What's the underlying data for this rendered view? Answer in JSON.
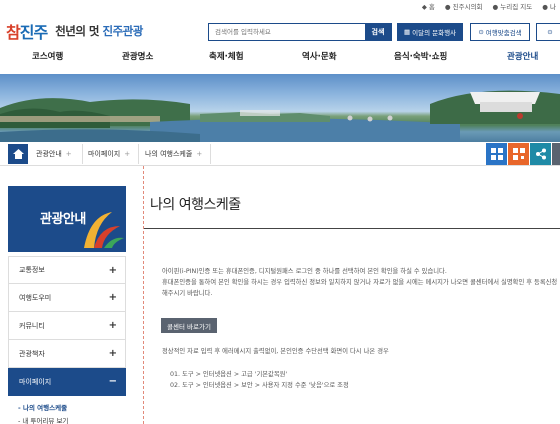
{
  "util_bar": [
    "홈",
    "진주시의회",
    "누리집 지도",
    "나"
  ],
  "logo": {
    "mark_left": "참",
    "mark_right": "진주",
    "slogan_pre": "천년의 멋",
    "slogan_bold": "진주관광"
  },
  "search": {
    "placeholder": "검색어를 입력하세요",
    "button": "검색"
  },
  "header_buttons": {
    "culture": "이달의 문화행사",
    "tailored": "여행맞춤검색",
    "third": ""
  },
  "gnb": [
    "코스여행",
    "관광명소",
    "축제·체험",
    "역사·문화",
    "음식·숙박·쇼핑",
    "관광안내"
  ],
  "breadcrumb": [
    "관광안내",
    "마이페이지",
    "나의 여행스케줄"
  ],
  "sidebar": {
    "title": "관광안내",
    "items": [
      {
        "label": "교통정보",
        "sign": "+"
      },
      {
        "label": "여행도우미",
        "sign": "+"
      },
      {
        "label": "커뮤니티",
        "sign": "+"
      },
      {
        "label": "관광책자",
        "sign": "+"
      },
      {
        "label": "마이페이지",
        "sign": "−"
      }
    ],
    "sub": [
      {
        "label": "- 나의 여행스케줄"
      },
      {
        "label": "- 내 투어리뷰 보기"
      }
    ]
  },
  "content": {
    "title": "나의 여행스케줄",
    "lines": [
      "아이핀(i-PIN)인증 또는 휴대폰인증, 디지털원패스 로그인 중 하나를 선택하여 본인 확인을 하실 수 있습니다.",
      "휴대폰인증을 통하여 본인 확인을 하시는 경우 입력하신 정보와 일치하지 않거나 자료가 없을 시에는 메시지가 나오면 콜센터에서 실명확인 후 등록신청",
      "해주시기 바랍니다."
    ],
    "button": "콜센터 바로가기",
    "note": "정상적인 자료 입력 후 에러메시지 출력없이, 본인인증 수단선택 화면이 다시 나온 경우",
    "steps": [
      "01. 도구 > 인터넷옵션 > 고급 '기본값복원'",
      "02. 도구 > 인터넷옵션 > 보안 > 사용자 지정 수준 '낮음'으로 조정"
    ]
  },
  "colors": {
    "primary": "#1c4b8a",
    "accent": "#d8402a",
    "icon_blue": "#2a74c6",
    "icon_orange": "#e8662a",
    "icon_teal": "#1f8aa6"
  }
}
